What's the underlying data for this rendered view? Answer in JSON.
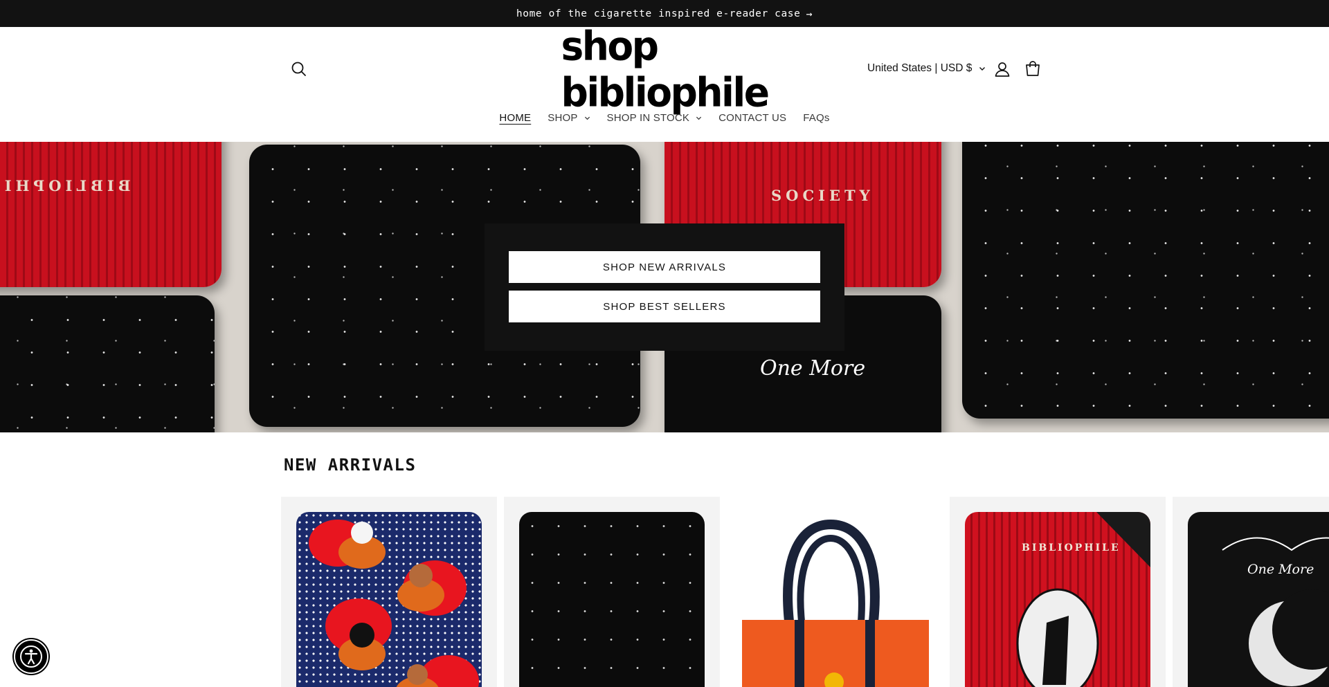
{
  "announcement": {
    "text": "home of the cigarette inspired e-reader case",
    "arrow": "→"
  },
  "header": {
    "logo_text": "shop bibliophile",
    "locale_label": "United States | USD $"
  },
  "nav": {
    "items": [
      {
        "label": "HOME",
        "active": true,
        "has_dropdown": false
      },
      {
        "label": "SHOP",
        "active": false,
        "has_dropdown": true
      },
      {
        "label": "SHOP IN STOCK",
        "active": false,
        "has_dropdown": true
      },
      {
        "label": "CONTACT US",
        "active": false,
        "has_dropdown": false
      },
      {
        "label": "FAQs",
        "active": false,
        "has_dropdown": false
      }
    ]
  },
  "hero": {
    "buttons": [
      {
        "label": "SHOP NEW ARRIVALS"
      },
      {
        "label": "SHOP BEST SELLERS"
      }
    ],
    "case_engravings": [
      "BIBLIOPHILE",
      "SOCIETY"
    ],
    "case_script": "One More"
  },
  "new_arrivals": {
    "title": "NEW ARRIVALS",
    "cards": [
      {
        "label": ""
      },
      {
        "label": ""
      },
      {
        "label": ""
      },
      {
        "label": "BIBLIOPHILE"
      },
      {
        "label": "One More"
      }
    ]
  },
  "icons": {
    "search": "search-icon",
    "account": "account-icon",
    "cart": "cart-icon",
    "accessibility": "accessibility-icon"
  },
  "colors": {
    "announcement_bg": "#121212",
    "hero_panel_bg": "#121212",
    "accent_red": "#c8101e",
    "text": "#121212"
  }
}
